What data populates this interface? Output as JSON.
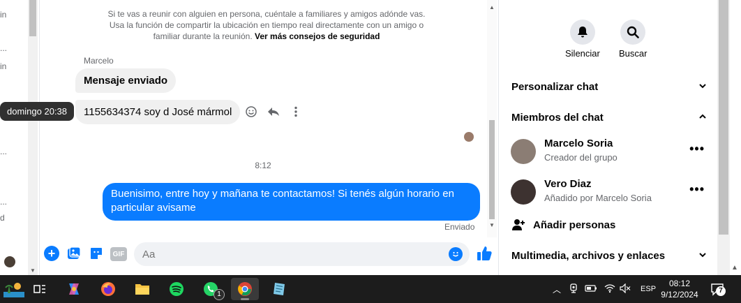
{
  "left_strip": {
    "fragments": [
      "in",
      "...",
      "in",
      "...",
      "...",
      "...",
      "d"
    ]
  },
  "chat": {
    "notice_text": "Si te vas a reunir con alguien en persona, cuéntale a familiares y amigos adónde vas. Usa la función de compartir la ubicación en tiempo real directamente con un amigo o familiar durante la reunión.",
    "notice_link": "Ver más consejos de seguridad",
    "sender_name": "Marcelo",
    "messages_in": [
      "Mensaje enviado",
      "1155634374 soy d José mármol"
    ],
    "tooltip": "domingo 20:38",
    "time_separator": "8:12",
    "message_out": "Buenisimo, entre hoy y mañana te contactamos! Si tenés algún horario en particular avisame",
    "status": "Enviado",
    "composer": {
      "placeholder": "Aa",
      "gif_label": "GIF"
    },
    "colors": {
      "accent": "#0a7cff",
      "bubble_in": "#f0f0f0"
    }
  },
  "info": {
    "actions": [
      {
        "label": "Silenciar",
        "icon": "bell-icon"
      },
      {
        "label": "Buscar",
        "icon": "search-icon"
      }
    ],
    "customize": "Personalizar chat",
    "members_header": "Miembros del chat",
    "members": [
      {
        "name": "Marcelo Soria",
        "sub": "Creador del grupo"
      },
      {
        "name": "Vero Diaz",
        "sub": "Añadido por Marcelo Soria"
      }
    ],
    "add_people": "Añadir personas",
    "media": "Multimedia, archivos y enlaces",
    "more_label": "•••"
  },
  "taskbar": {
    "whatsapp_badge": "1",
    "language": "ESP",
    "time": "08:12",
    "date": "9/12/2024",
    "notifications": "7"
  }
}
